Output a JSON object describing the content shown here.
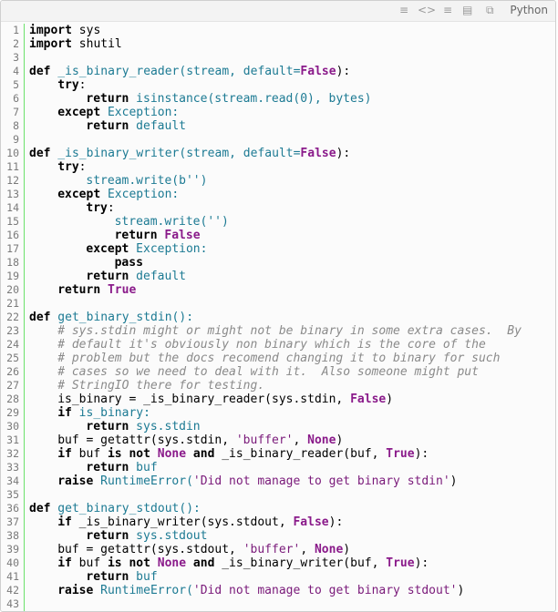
{
  "toolbar": {
    "icons": [
      "menu-icon",
      "view-source-icon",
      "menu-icon-2",
      "copy-icon",
      "popup-icon"
    ],
    "language": "Python"
  },
  "lines": [
    "1",
    "2",
    "3",
    "4",
    "5",
    "6",
    "7",
    "8",
    "9",
    "10",
    "11",
    "12",
    "13",
    "14",
    "15",
    "16",
    "17",
    "18",
    "19",
    "20",
    "21",
    "22",
    "23",
    "24",
    "25",
    "26",
    "27",
    "28",
    "29",
    "30",
    "31",
    "32",
    "33",
    "34",
    "35",
    "36",
    "37",
    "38",
    "39",
    "40",
    "41",
    "42",
    "43"
  ],
  "code": {
    "l1": [
      "import",
      " sys"
    ],
    "l2": [
      "import",
      " shutil"
    ],
    "l4": [
      "def",
      " _is_binary_reader(stream, default=",
      "False",
      "):"
    ],
    "l5": [
      "try",
      ":"
    ],
    "l6": [
      "return",
      " isinstance(stream.read(0), bytes)"
    ],
    "l7": [
      "except",
      " Exception:"
    ],
    "l8": [
      "return",
      " default"
    ],
    "l10": [
      "def",
      " _is_binary_writer(stream, default=",
      "False",
      "):"
    ],
    "l11": [
      "try",
      ":"
    ],
    "l12": [
      "stream.write(b'')"
    ],
    "l13": [
      "except",
      " Exception:"
    ],
    "l14": [
      "try",
      ":"
    ],
    "l15": [
      "stream.write('')"
    ],
    "l16": [
      "return",
      " False"
    ],
    "l17": [
      "except",
      " Exception:"
    ],
    "l18": [
      "pass"
    ],
    "l19": [
      "return",
      " default"
    ],
    "l20": [
      "return",
      " True"
    ],
    "l22": [
      "def",
      " get_binary_stdin():"
    ],
    "l23": "# sys.stdin might or might not be binary in some extra cases.  By",
    "l24": "# default it's obviously non binary which is the core of the",
    "l25": "# problem but the docs recomend changing it to binary for such",
    "l26": "# cases so we need to deal with it.  Also someone might put",
    "l27": "# StringIO there for testing.",
    "l28": [
      "is_binary = _is_binary_reader(sys.stdin, ",
      "False",
      ")"
    ],
    "l29": [
      "if",
      " is_binary:"
    ],
    "l30": [
      "return",
      " sys.stdin"
    ],
    "l31": [
      "buf = getattr(sys.stdin, ",
      "'buffer'",
      ", ",
      "None",
      ")"
    ],
    "l32": [
      "if",
      " buf ",
      "is not",
      " ",
      "None",
      " ",
      "and",
      " _is_binary_reader(buf, ",
      "True",
      "):"
    ],
    "l33": [
      "return",
      " buf"
    ],
    "l34": [
      "raise",
      " RuntimeError(",
      "'Did not manage to get binary stdin'",
      ")"
    ],
    "l36": [
      "def",
      " get_binary_stdout():"
    ],
    "l37": [
      "if",
      " _is_binary_writer(sys.stdout, ",
      "False",
      "):"
    ],
    "l38": [
      "return",
      " sys.stdout"
    ],
    "l39": [
      "buf = getattr(sys.stdout, ",
      "'buffer'",
      ", ",
      "None",
      ")"
    ],
    "l40": [
      "if",
      " buf ",
      "is not",
      " ",
      "None",
      " ",
      "and",
      " _is_binary_writer(buf, ",
      "True",
      "):"
    ],
    "l41": [
      "return",
      " buf"
    ],
    "l42": [
      "raise",
      " RuntimeError(",
      "'Did not manage to get binary stdout'",
      ")"
    ]
  },
  "colors": {
    "gutter_border": "#6ce26c",
    "keyword": "#000000",
    "function": "#1c7a93",
    "comment": "#8a8a8a",
    "string": "#7a1a7a",
    "constant": "#8a1a8a"
  }
}
